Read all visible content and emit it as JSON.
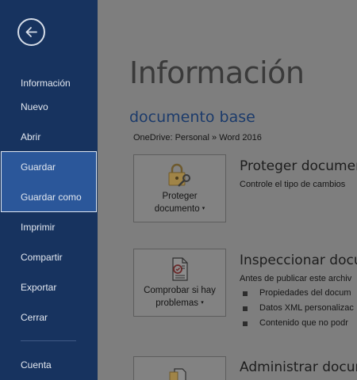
{
  "sidebar": {
    "back_label": "",
    "items": [
      {
        "label": "Información"
      },
      {
        "label": "Nuevo"
      },
      {
        "label": "Abrir"
      },
      {
        "label": "Guardar"
      },
      {
        "label": "Guardar como"
      },
      {
        "label": "Imprimir"
      },
      {
        "label": "Compartir"
      },
      {
        "label": "Exportar"
      },
      {
        "label": "Cerrar"
      },
      {
        "label": "Cuenta"
      }
    ]
  },
  "main": {
    "title": "Información",
    "document_name": "documento base",
    "document_path": "OneDrive: Personal » Word 2016",
    "sections": [
      {
        "button_label_line1": "Proteger",
        "button_label_line2": "documento",
        "title": "Proteger documer",
        "description": "Controle el tipo de cambios",
        "icon": "lock-icon"
      },
      {
        "button_label_line1": "Comprobar si hay",
        "button_label_line2": "problemas",
        "title": "Inspeccionar docu",
        "description": "Antes de publicar este archiv",
        "bullets": [
          "Propiedades del docum",
          "Datos XML personalizac",
          "Contenido que no podr"
        ],
        "icon": "inspect-document-icon"
      },
      {
        "title": "Administrar docun",
        "icon": "manage-document-icon"
      }
    ],
    "caret": "▾"
  },
  "colors": {
    "sidebar_bg": "#17335f",
    "selected_bg": "#2b579a",
    "content_overlay": "#7e7e7e"
  }
}
